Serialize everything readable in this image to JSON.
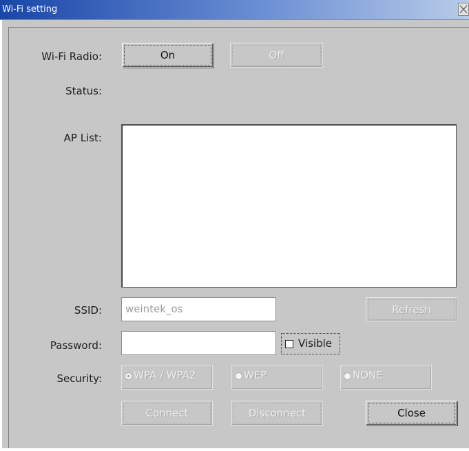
{
  "window": {
    "title": "Wi-Fi setting"
  },
  "labels": {
    "radio": "Wi-Fi Radio:",
    "status": "Status:",
    "ap_list": "AP List:",
    "ssid": "SSID:",
    "password": "Password:",
    "security": "Security:"
  },
  "buttons": {
    "on": "On",
    "off": "Off",
    "refresh": "Refresh",
    "connect": "Connect",
    "disconnect": "Disconnect",
    "close": "Close"
  },
  "ssid": {
    "value": "weintek_os"
  },
  "password": {
    "value": ""
  },
  "visible": {
    "label": "Visible",
    "checked": false
  },
  "security": {
    "options": [
      "WPA / WPA2",
      "WEP",
      "NONE"
    ],
    "selected": "WPA / WPA2"
  },
  "status": {
    "value": ""
  },
  "ap_list": {
    "items": []
  },
  "colors": {
    "title_start": "#1846a8",
    "dialog_bg": "#c7c7c7"
  }
}
